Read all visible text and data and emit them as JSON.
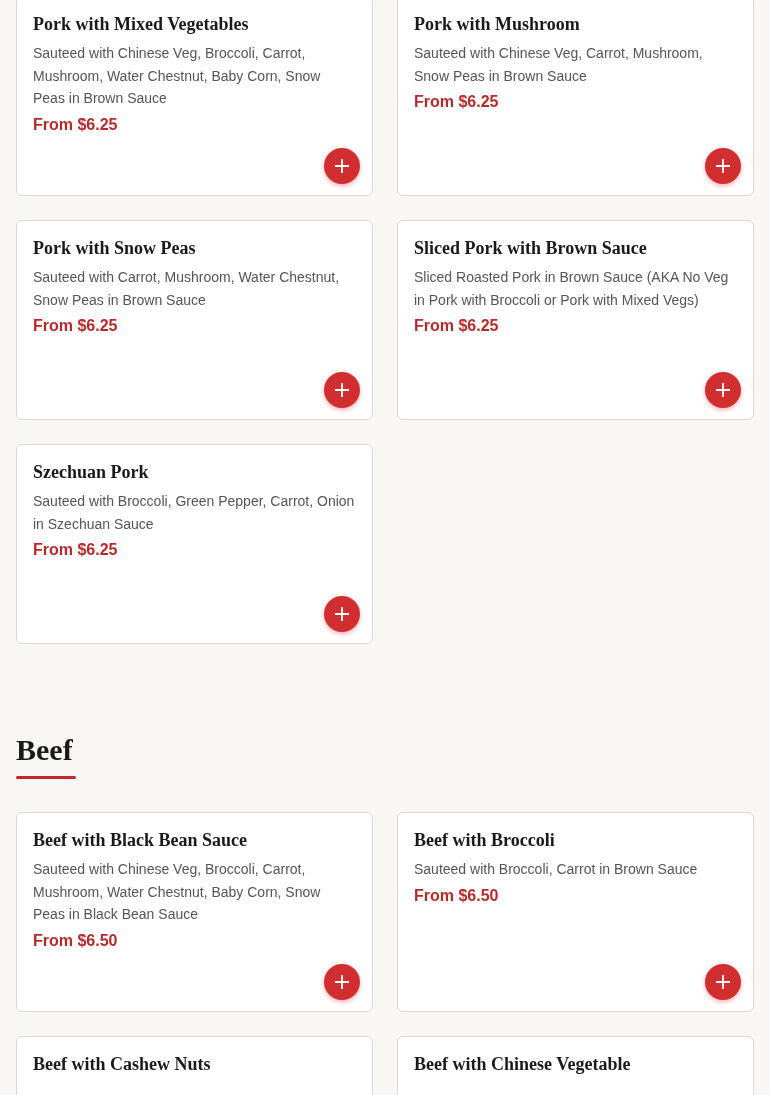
{
  "sections": [
    {
      "items": [
        {
          "name": "Pork with Mixed Vegetables",
          "description": "Sauteed with Chinese Veg, Broccoli, Carrot, Mushroom, Water Chestnut, Baby Corn, Snow Peas in Brown Sauce",
          "price": "From $6.25"
        },
        {
          "name": "Pork with Mushroom",
          "description": "Sauteed with Chinese Veg, Carrot, Mushroom, Snow Peas in Brown Sauce",
          "price": "From $6.25"
        },
        {
          "name": "Pork with Snow Peas",
          "description": "Sauteed with Carrot, Mushroom, Water Chestnut, Snow Peas in Brown Sauce",
          "price": "From $6.25"
        },
        {
          "name": "Sliced Pork with Brown Sauce",
          "description": "Sliced Roasted Pork in Brown Sauce (AKA No Veg in Pork with Broccoli or Pork with Mixed Vegs)",
          "price": "From $6.25"
        },
        {
          "name": "Szechuan Pork",
          "description": "Sauteed with Broccoli, Green Pepper, Carrot, Onion in Szechuan Sauce",
          "price": "From $6.25"
        }
      ]
    },
    {
      "title": "Beef",
      "items": [
        {
          "name": "Beef with Black Bean Sauce",
          "description": "Sauteed with Chinese Veg, Broccoli, Carrot, Mushroom, Water Chestnut, Baby Corn, Snow Peas in Black Bean Sauce",
          "price": "From $6.50"
        },
        {
          "name": "Beef with Broccoli",
          "description": "Sauteed with Broccoli, Carrot in Brown Sauce",
          "price": "From $6.50"
        },
        {
          "name": "Beef with Cashew Nuts"
        },
        {
          "name": "Beef with Chinese Vegetable"
        }
      ]
    }
  ]
}
